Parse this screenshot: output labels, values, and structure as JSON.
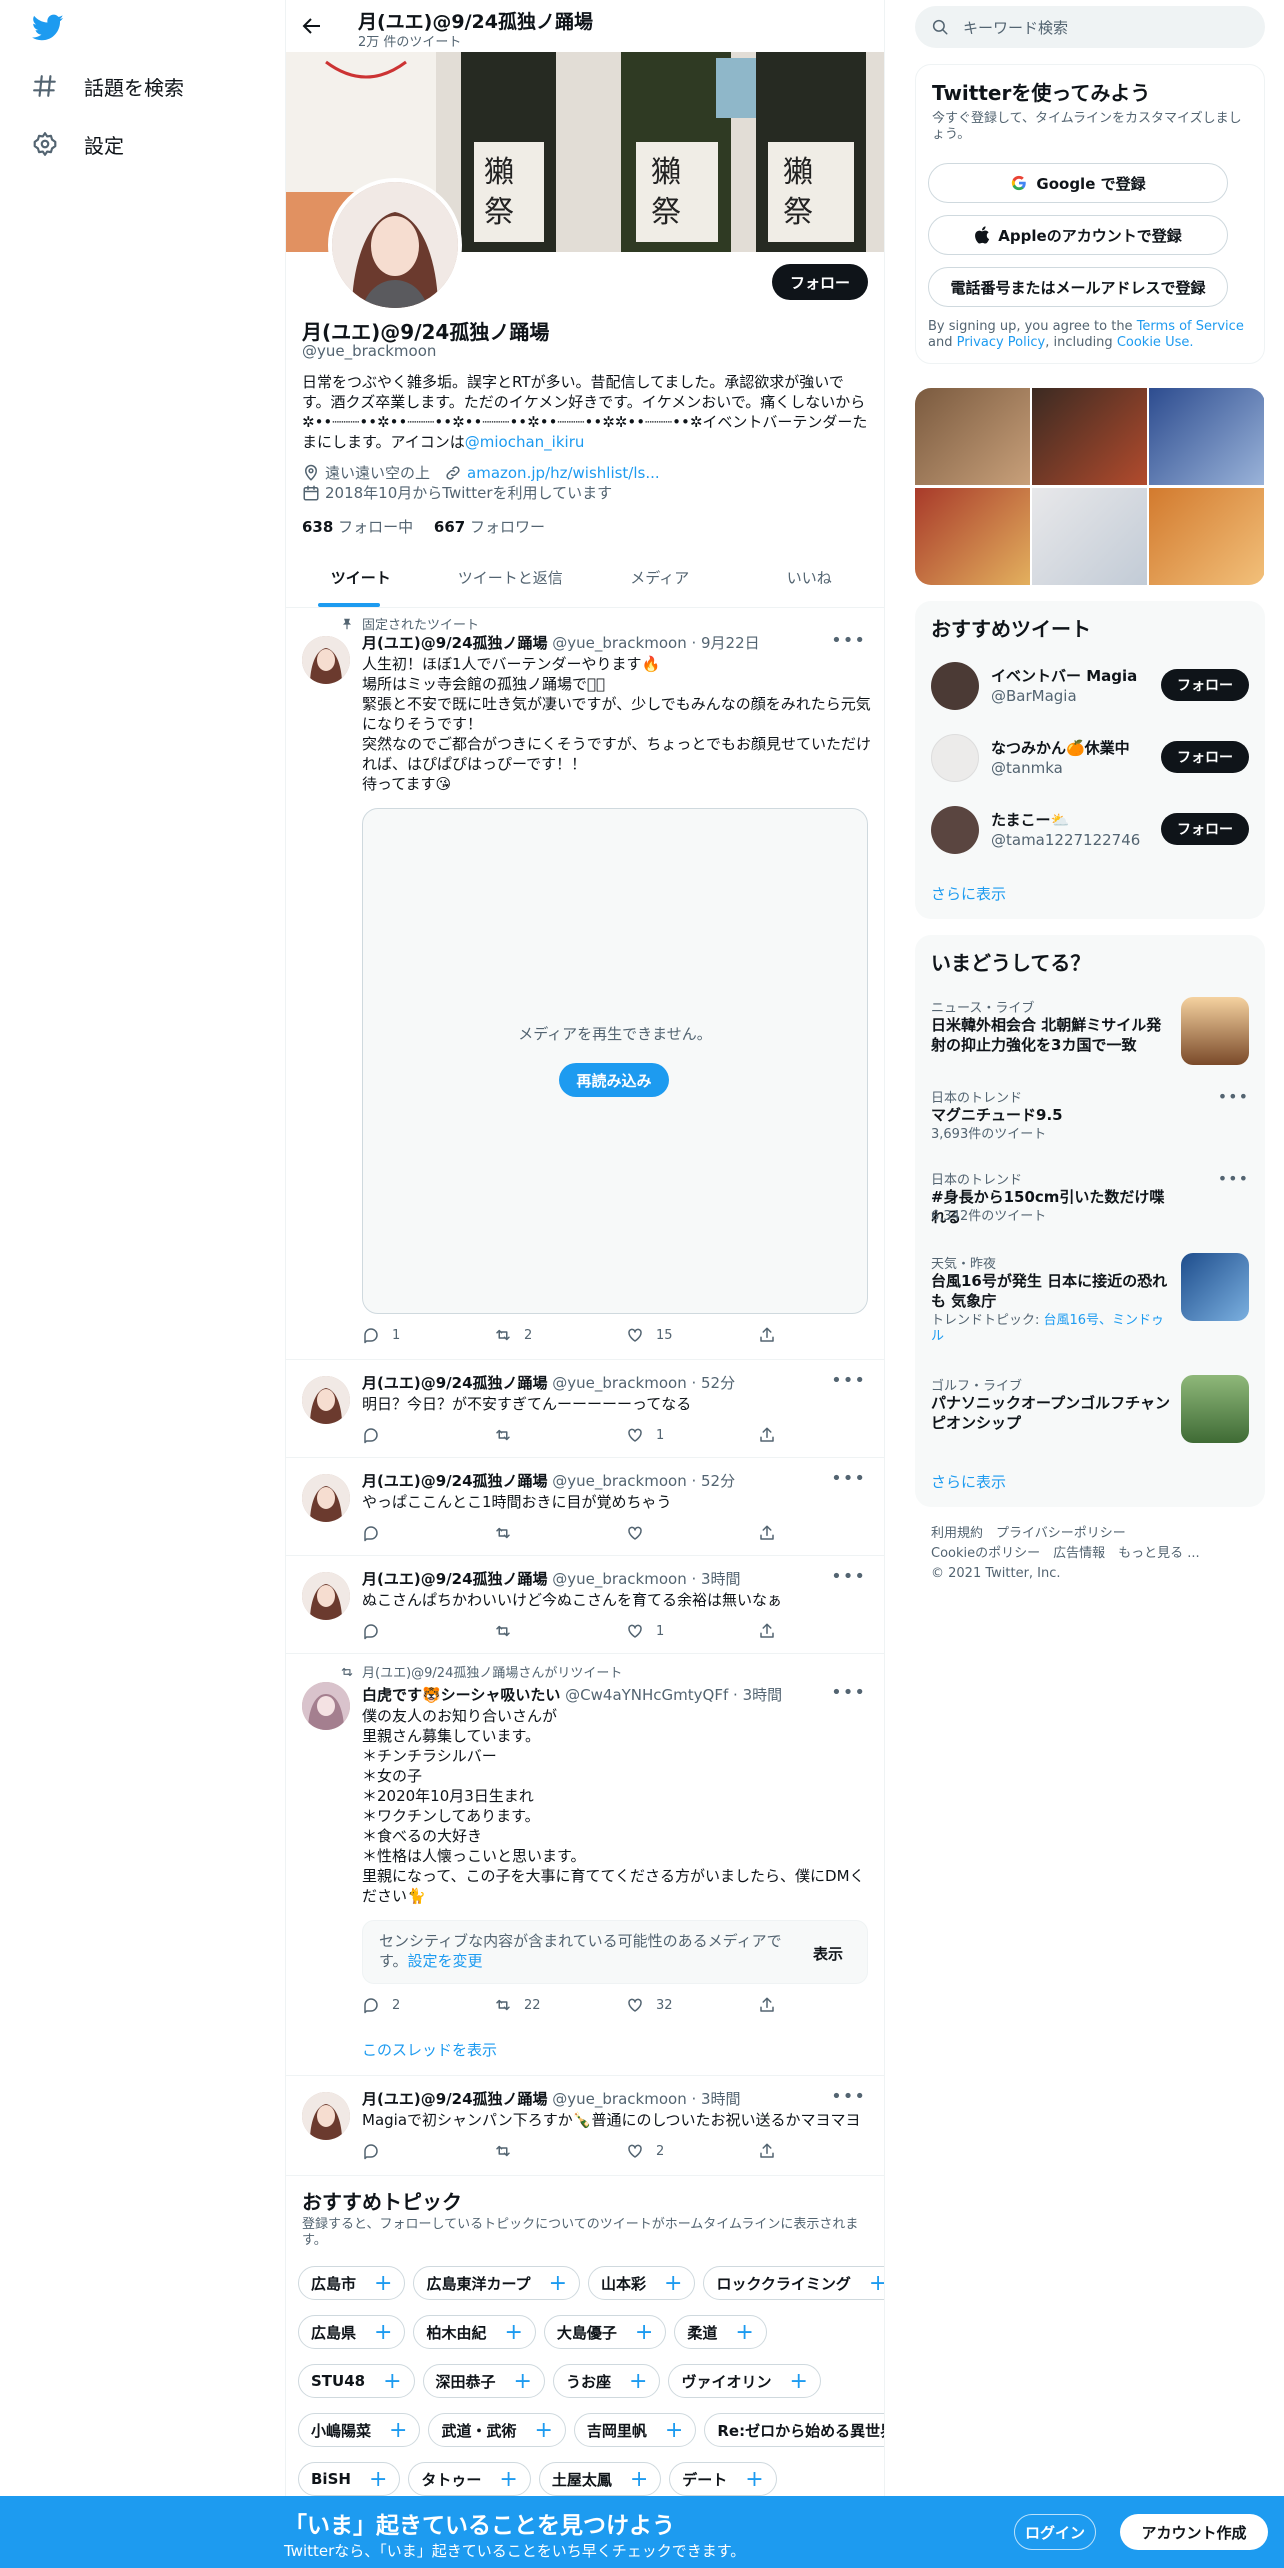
{
  "nav": {
    "explore": "話題を検索",
    "settings": "設定"
  },
  "header": {
    "title": "月(ユエ)@9/24孤独ノ踊場",
    "tweet_count": "2万 件のツイート"
  },
  "profile": {
    "follow": "フォロー",
    "name": "月(ユエ)@9/24孤独ノ踊場",
    "handle": "@yue_brackmoon",
    "bio": "日常をつぶやく雑多垢。誤字とRTが多い。昔配信してました。承認欲求が強いです。酒クズ卒業します。ただのイケメン好きです。イケメンおいで。痛くしないから✲••┈┈┈••✲••┈┈┈••✲••┈┈┈••✲••┈┈┈••✲✲••┈┈┈••✲イベントバーテンダーたまにします。アイコンは",
    "bio_link": "@miochan_ikiru",
    "location": "遠い遠い空の上",
    "url": "amazon.jp/hz/wishlist/ls...",
    "joined": "2018年10月からTwitterを利用しています",
    "following_count": "638",
    "following_label": "フォロー中",
    "followers_count": "667",
    "followers_label": "フォロワー"
  },
  "tabs": [
    "ツイート",
    "ツイートと返信",
    "メディア",
    "いいね"
  ],
  "tweets": [
    {
      "context": "固定されたツイート",
      "name": "月(ユエ)@9/24孤独ノ踊場",
      "handle": "@yue_brackmoon",
      "time": "9月22日",
      "text": "人生初！ほぼ1人でバーテンダーやります🔥\n場所はミッ寺会館の孤独ノ踊場です🏻\n緊張と不安で既に吐き気が凄いですが、少しでもみんなの顔をみれたら元気になりそうです！\n突然なのでご都合がつきにくそうですが、ちょっとでもお顔見せていただければ、はぴぱぴはっぴーです！！\n待ってます😘",
      "media_msg": "メディアを再生できません。",
      "reload": "再読み込み",
      "replies": "1",
      "retweets": "2",
      "likes": "15"
    },
    {
      "name": "月(ユエ)@9/24孤独ノ踊場",
      "handle": "@yue_brackmoon",
      "time": "52分",
      "text": "明日？今日？が不安すぎてんーーーーーってなる",
      "replies": "",
      "retweets": "",
      "likes": "1"
    },
    {
      "name": "月(ユエ)@9/24孤独ノ踊場",
      "handle": "@yue_brackmoon",
      "time": "52分",
      "text": "やっぱここんとこ1時間おきに目が覚めちゃう",
      "replies": "",
      "retweets": "",
      "likes": ""
    },
    {
      "name": "月(ユエ)@9/24孤独ノ踊場",
      "handle": "@yue_brackmoon",
      "time": "3時間",
      "text": "ぬこさんぱちかわいいけど今ぬこさんを育てる余裕は無いなぁ",
      "replies": "",
      "retweets": "",
      "likes": "1"
    },
    {
      "context": "月(ユエ)@9/24孤独ノ踊場さんがリツイート",
      "name": "白虎です🐯シーシャ吸いたい",
      "handle": "@Cw4aYNHcGmtyQFf",
      "time": "3時間",
      "text": "僕の友人のお知り合いさんが\n里親さん募集しています。\n＊チンチラシルバー\n＊女の子\n＊2020年10月3日生まれ\n＊ワクチンしてあります。\n＊食べるの大好き\n＊性格は人懐っこいと思います。\n里親になって、この子を大事に育ててくださる方がいましたら、僕にDMください🐈",
      "sensitive": "センシティブな内容が含まれている可能性のあるメディアです。",
      "sensitive_link": "設定を変更",
      "show": "表示",
      "replies": "2",
      "retweets": "22",
      "likes": "32",
      "thread": "このスレッドを表示"
    },
    {
      "name": "月(ユエ)@9/24孤独ノ踊場",
      "handle": "@yue_brackmoon",
      "time": "3時間",
      "text": "Magiaで初シャンパン下ろすか🍾普通にのしついたお祝い送るかマヨマヨ",
      "replies": "",
      "retweets": "",
      "likes": "2"
    }
  ],
  "topics": {
    "title": "おすすめトピック",
    "desc": "登録すると、フォローしているトピックについてのツイートがホームタイムラインに表示されます。",
    "rows": [
      [
        "広島市",
        "広島東洋カープ",
        "山本彩",
        "ロッククライミング"
      ],
      [
        "広島県",
        "柏木由紀",
        "大島優子",
        "柔道"
      ],
      [
        "STU48",
        "深田恭子",
        "うお座",
        "ヴァイオリン"
      ],
      [
        "小嶋陽菜",
        "武道・武術",
        "吉岡里帆",
        "Re:ゼロから始める異世界生活"
      ],
      [
        "BiSH",
        "タトゥー",
        "土屋太鳳",
        "デート"
      ]
    ]
  },
  "search": {
    "placeholder": "キーワード検索"
  },
  "signup": {
    "title": "Twitterを使ってみよう",
    "desc": "今すぐ登録して、タイムラインをカスタマイズしましょう。",
    "google": "Google で登録",
    "apple": "Appleのアカウントで登録",
    "phone": "電話番号またはメールアドレスで登録",
    "legal_pre": "By signing up, you agree to the ",
    "terms": "Terms of Service",
    "and": " and ",
    "privacy": "Privacy Policy",
    "including": ", including ",
    "cookie": "Cookie Use."
  },
  "who": {
    "title": "おすすめツイート",
    "users": [
      {
        "name": "イベントバー Magia",
        "handle": "@BarMagia",
        "follow": "フォロー"
      },
      {
        "name": "なつみかん🍊休業中",
        "handle": "@tanmka",
        "follow": "フォロー"
      },
      {
        "name": "たまこー⛅",
        "handle": "@tama1227122746",
        "follow": "フォロー"
      }
    ],
    "more": "さらに表示"
  },
  "trends": {
    "title": "いまどうしてる？",
    "items": [
      {
        "context": "ニュース・ライブ",
        "title": "日米韓外相会合 北朝鮮ミサイル発射の抑止力強化を3カ国で一致"
      },
      {
        "context": "日本のトレンド",
        "title": "マグニチュード9.5",
        "count": "3,693件のツイート"
      },
      {
        "context": "日本のトレンド",
        "title": "#身長から150cm引いた数だけ喋れる",
        "count": "6,342件のツイート"
      },
      {
        "context": "天気・昨夜",
        "title": "台風16号が発生 日本に接近の恐れも 気象庁",
        "topics_label": "トレンドトピック: ",
        "topics": "台風16号、ミンドゥル"
      },
      {
        "context": "ゴルフ・ライブ",
        "title": "パナソニックオープンゴルフチャンピオンシップ"
      }
    ],
    "more": "さらに表示"
  },
  "footer": {
    "l1": "利用規約　プライバシーポリシー",
    "l2": "Cookieのポリシー　広告情報　もっと見る ...",
    "l3": "© 2021 Twitter, Inc."
  },
  "bottombar": {
    "headline": "「いま」起きていることを見つけよう",
    "sub": "Twitterなら、「いま」起きていることをいち早くチェックできます。",
    "login": "ログイン",
    "signup": "アカウント作成"
  }
}
